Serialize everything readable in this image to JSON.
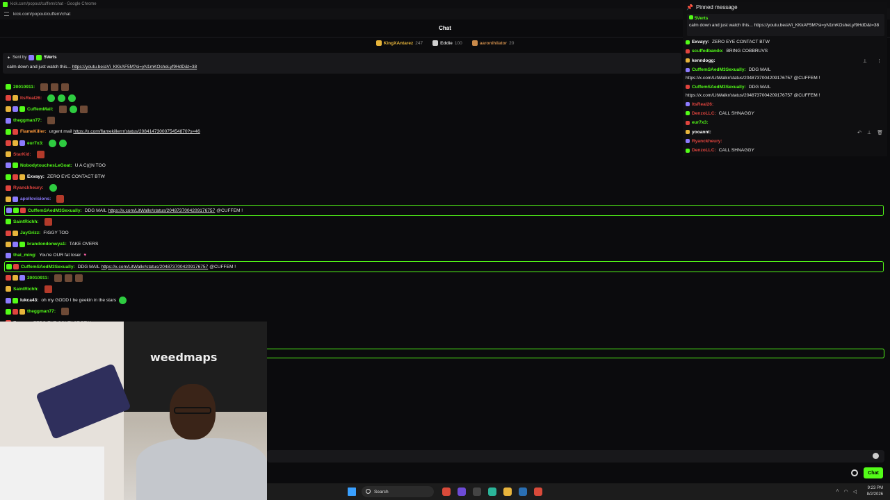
{
  "browser": {
    "title": "kick.com/popout/cuffem/chat - Google Chrome",
    "url": "kick.com/popout/cuffem/chat"
  },
  "chat": {
    "header": "Chat",
    "leaderboard": [
      {
        "name": "KingXAntarez",
        "count": "247",
        "color": "#e7b53b"
      },
      {
        "name": "Eddie",
        "count": "100",
        "color": "#cfcfcf"
      },
      {
        "name": "aaronihilator",
        "count": "20",
        "color": "#c98a4a"
      }
    ],
    "pinned": {
      "sent_by_label": "Sent by",
      "sender": "5Verts",
      "text": "calm down and just watch this... ",
      "link": "https://youtu.be/aVi_KKkAF5M?si=yN1mKOsheLyf9HdD&t=38"
    },
    "messages": [
      {
        "user": "20010911:",
        "color": "#53fc18",
        "text": "",
        "emotes": [
          "brown",
          "brown",
          "brown"
        ]
      },
      {
        "user": "ItsReal26:",
        "color": "#e0443e",
        "text": "",
        "emotes": [
          "green",
          "green",
          "green"
        ]
      },
      {
        "user": "CuffemMail:",
        "color": "#53fc18",
        "text": "",
        "emotes": [
          "brown",
          "green",
          "brown"
        ]
      },
      {
        "user": "theggman77:",
        "color": "#53fc18",
        "text": "",
        "emotes": [
          "brown"
        ]
      },
      {
        "user": "FlameKiller:",
        "color": "#ff9a3c",
        "text": "urgent mail ",
        "link": "https://x.com/flamekillerrr/status/2084147300075454870?s=46",
        "emotes": []
      },
      {
        "user": "eur7x3:",
        "color": "#53fc18",
        "text": "",
        "emotes": [
          "green",
          "green"
        ]
      },
      {
        "user": "StarKid:",
        "color": "#e0443e",
        "text": "",
        "emotes": [
          "red"
        ]
      },
      {
        "user": "NobodytouchesLeGoat:",
        "color": "#53fc18",
        "text": "U A C(((N TOO",
        "emotes": []
      },
      {
        "user": "Exvayy:",
        "color": "#ffffff",
        "text": "ZERO EYE CONTACT BTW",
        "emotes": []
      },
      {
        "user": "Ryanckheury:",
        "color": "#e0443e",
        "text": "",
        "emotes": [
          "green"
        ]
      },
      {
        "user": "apollovisions:",
        "color": "#8d7bff",
        "text": "",
        "emotes": [
          "red"
        ]
      },
      {
        "user": "CuffemSAedM3Sexually:",
        "color": "#53fc18",
        "text": "DDG MAIL ",
        "link": "https://x.com/LitWalkr/status/2048737004209176757",
        "suffix": " @CUFFEM !",
        "highlight": true,
        "emotes": []
      },
      {
        "user": "SaintRichh:",
        "color": "#53fc18",
        "text": "",
        "emotes": [
          "red"
        ]
      },
      {
        "user": "JayGrizz:",
        "color": "#53fc18",
        "text": "FIGGY TOO",
        "emotes": []
      },
      {
        "user": "brandondonwya1:",
        "color": "#53fc18",
        "text": "TAKE OVERS",
        "emotes": []
      },
      {
        "user": "thai_ming:",
        "color": "#53fc18",
        "text": "You're OUR fat loser",
        "heart": true,
        "emotes": []
      },
      {
        "user": "CuffemSAedM3Sexually:",
        "color": "#53fc18",
        "text": "DDG MAIL ",
        "link": "https://x.com/LitWalkr/status/2048737004209176757",
        "suffix": " @CUFFEM !",
        "highlight": true,
        "emotes": []
      },
      {
        "user": "20010911:",
        "color": "#53fc18",
        "text": "",
        "emotes": [
          "brown",
          "brown",
          "brown"
        ]
      },
      {
        "user": "SaintRichh:",
        "color": "#53fc18",
        "text": "",
        "emotes": [
          "red"
        ]
      },
      {
        "user": "lukca43:",
        "color": "#ffffff",
        "text": "oh my GODD I be geekin in the stars",
        "emotes": [
          "green"
        ]
      },
      {
        "user": "theggman77:",
        "color": "#53fc18",
        "text": "",
        "emotes": [
          "brown"
        ]
      },
      {
        "user": "Exvayy:",
        "color": "#ffffff",
        "text": "ZERO EYE CONTACT BTW",
        "emotes": []
      }
    ],
    "send_button": "Chat"
  },
  "popup": {
    "title": "Pinned message",
    "pinned_user": "5Verts",
    "pinned_text": "calm down and just watch this... https://youtu.be/aVi_KKkAF5M?si=yN1mKOsheLyf9HdD&t=38",
    "lines": [
      {
        "user": "Exvayy:",
        "color": "#ffffff",
        "text": "ZERO EYE CONTACT BTW"
      },
      {
        "user": "scuffedbando:",
        "color": "#53fc18",
        "text": "BRING COBBRUVS"
      },
      {
        "user": "kenndogg:",
        "color": "#ffffff",
        "text": ""
      },
      {
        "user": "CuffemSAedM3Sexually:",
        "color": "#53fc18",
        "text": "DDG MAIL"
      },
      {
        "user": "",
        "color": "#ffffff",
        "text": "https://x.com/LitWalkr/status/2048737004209176757 @CUFFEM !"
      },
      {
        "user": "CuffemSAedM3Sexually:",
        "color": "#53fc18",
        "text": "DDG MAIL"
      },
      {
        "user": "",
        "color": "#ffffff",
        "text": "https://x.com/LitWalkr/status/2048737004209176757 @CUFFEM !"
      },
      {
        "user": "ItsReal26:",
        "color": "#e0443e",
        "text": ""
      },
      {
        "user": "DenzoLLC:",
        "color": "#e0443e",
        "text": "CALL SHNAGGY"
      },
      {
        "user": "eur7x3:",
        "color": "#53fc18",
        "text": ""
      },
      {
        "user": "yooannt:",
        "color": "#ffffff",
        "text": ""
      },
      {
        "user": "Ryanckheury:",
        "color": "#e0443e",
        "text": ""
      },
      {
        "user": "DenzoLLC:",
        "color": "#e0443e",
        "text": "CALL SHNAGGY"
      }
    ]
  },
  "webcam": {
    "logo_text": "weedmaps"
  },
  "taskbar": {
    "search_label": "Search",
    "time": "9:23 PM",
    "date": "8/2/2026"
  }
}
